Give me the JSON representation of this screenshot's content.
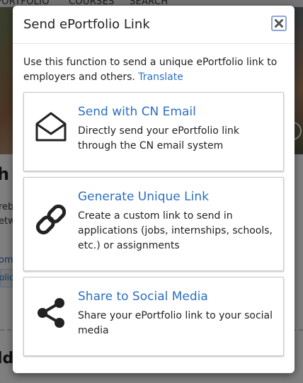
{
  "background": {
    "nav": [
      "PORTFOLIO",
      "COURSES",
      "SEARCH"
    ],
    "partial_heading": "h",
    "partial_lines": [
      "reb",
      "etwo"
    ],
    "partial_links": [
      "om",
      "olic"
    ],
    "partial_bottom_heading": "ld"
  },
  "modal": {
    "title": "Send ePortfolio Link",
    "intro_text": "Use this function to send a unique ePortfolio link to employers and others.",
    "translate_link": "Translate",
    "options": [
      {
        "title": "Send with CN Email",
        "description": "Directly send your ePortfolio link through the CN email system",
        "icon": "envelope-open-icon"
      },
      {
        "title": "Generate Unique Link",
        "description": "Create a custom link to send in applications (jobs, internships, schools, etc.) or assignments",
        "icon": "link-icon"
      },
      {
        "title": "Share to Social Media",
        "description": "Share your ePortfolio link to your social media",
        "icon": "share-icon"
      }
    ]
  },
  "colors": {
    "link": "#2c6fbf",
    "text": "#222222",
    "overlay": "rgba(0,0,0,0.5)"
  }
}
